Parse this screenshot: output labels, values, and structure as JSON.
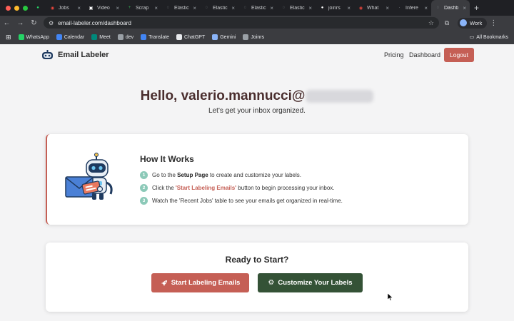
{
  "browser": {
    "tabs": [
      {
        "label": "",
        "color": "#25d366",
        "glyph": "●",
        "pinned": true
      },
      {
        "label": "Jobs",
        "color": "#e8453c",
        "glyph": "◉"
      },
      {
        "label": "Video",
        "color": "#ffffff",
        "glyph": "▣"
      },
      {
        "label": "Scrap",
        "color": "#34a853",
        "glyph": "+"
      },
      {
        "label": "Elastic",
        "color": "#9aa0a6",
        "glyph": "◌"
      },
      {
        "label": "Elastic",
        "color": "#9aa0a6",
        "glyph": "◌"
      },
      {
        "label": "Elastic",
        "color": "#9aa0a6",
        "glyph": "◌"
      },
      {
        "label": "Elastic",
        "color": "#9aa0a6",
        "glyph": "◌"
      },
      {
        "label": "joinrs",
        "color": "#ffffff",
        "glyph": "●"
      },
      {
        "label": "What",
        "color": "#e8453c",
        "glyph": "◉"
      },
      {
        "label": "Infere",
        "color": "#9aa0a6",
        "glyph": "·"
      },
      {
        "label": "Dashb",
        "color": "#9aa0a6",
        "glyph": "◌",
        "active": true
      }
    ],
    "new_tab": "+",
    "url": "email-labeler.com/dashboard",
    "profile": "Work",
    "bookmarks": [
      {
        "label": "WhatsApp",
        "color": "#25d366"
      },
      {
        "label": "Calendar",
        "color": "#4285f4"
      },
      {
        "label": "Meet",
        "color": "#00897b"
      },
      {
        "label": "dev",
        "color": "#9aa0a6"
      },
      {
        "label": "Translate",
        "color": "#4285f4"
      },
      {
        "label": "ChatGPT",
        "color": "#e8eaed"
      },
      {
        "label": "Gemini",
        "color": "#8ab4f8"
      },
      {
        "label": "Joinrs",
        "color": "#9aa0a6"
      }
    ],
    "all_bookmarks": "All Bookmarks"
  },
  "nav": {
    "brand": "Email Labeler",
    "pricing": "Pricing",
    "dashboard": "Dashboard",
    "logout": "Logout"
  },
  "greeting": {
    "hello": "Hello, valerio.mannucci@",
    "subtitle": "Let's get your inbox organized."
  },
  "how_it_works": {
    "title": "How It Works",
    "step1": {
      "num": "1",
      "pre": "Go to the ",
      "bold": "Setup Page",
      "post": " to create and customize your labels."
    },
    "step2": {
      "num": "2",
      "pre": "Click the ",
      "highlight": "'Start Labeling Emails'",
      "post": " button to begin processing your inbox."
    },
    "step3": {
      "num": "3",
      "text": "Watch the 'Recent Jobs' table to see your emails get organized in real-time."
    }
  },
  "ready": {
    "title": "Ready to Start?",
    "start_button": "Start Labeling Emails",
    "customize_button": "Customize Your Labels"
  },
  "colors": {
    "accent": "#c55f55",
    "secondary": "#345236",
    "step": "#8cc9b8"
  }
}
